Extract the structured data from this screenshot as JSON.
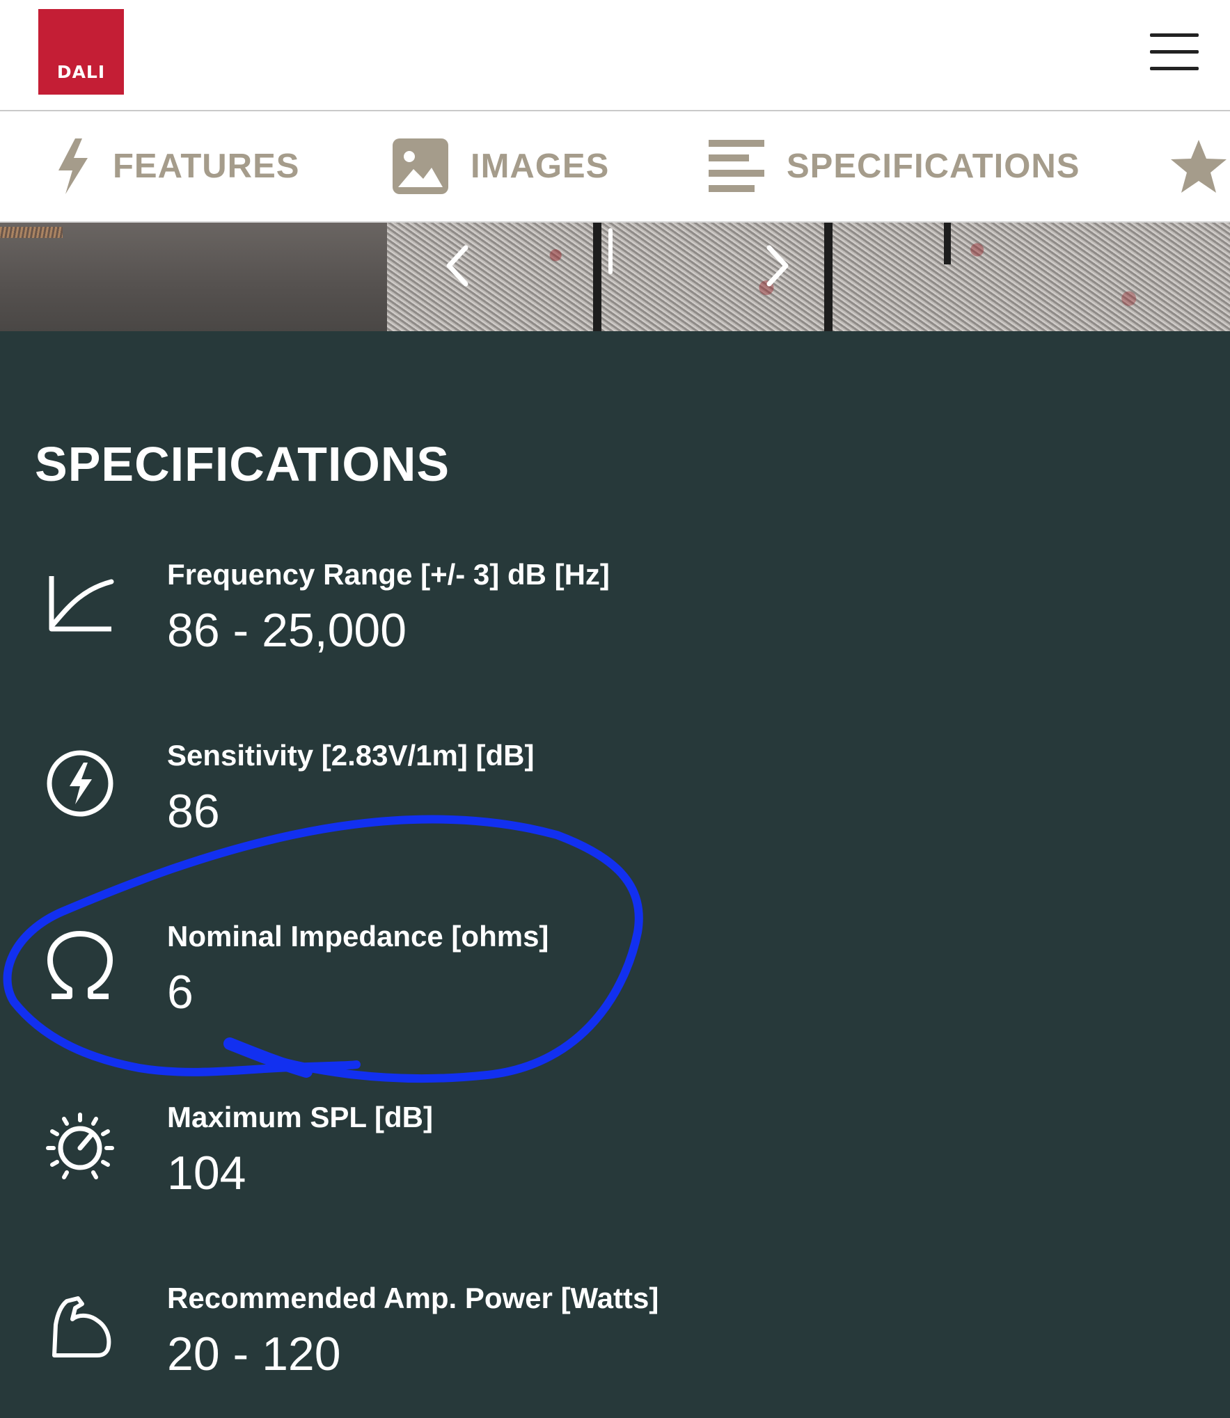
{
  "header": {
    "logo_text": "DALI",
    "brand_color": "#c41e35",
    "menu_icon": "hamburger-menu-icon"
  },
  "tabs": [
    {
      "label": "FEATURES",
      "icon": "lightning-icon"
    },
    {
      "label": "IMAGES",
      "icon": "image-icon"
    },
    {
      "label": "SPECIFICATIONS",
      "icon": "specifications-list-icon"
    },
    {
      "label": "",
      "icon": "star-icon"
    }
  ],
  "tab_color": "#a59c8b",
  "gallery": {
    "prev_icon": "chevron-left-icon",
    "next_icon": "chevron-right-icon"
  },
  "specifications": {
    "title": "SPECIFICATIONS",
    "background": "#27393a",
    "items": [
      {
        "label": "Frequency Range [+/- 3] dB [Hz]",
        "value": "86 - 25,000",
        "icon": "frequency-curve-icon"
      },
      {
        "label": "Sensitivity [2.83V/1m] [dB]",
        "value": "86",
        "icon": "lightning-circle-icon"
      },
      {
        "label": "Nominal Impedance [ohms]",
        "value": "6",
        "icon": "omega-icon"
      },
      {
        "label": "Maximum SPL [dB]",
        "value": "104",
        "icon": "gauge-icon"
      },
      {
        "label": "Recommended Amp. Power [Watts]",
        "value": "20 - 120",
        "icon": "flexed-arm-icon"
      }
    ]
  },
  "annotation": {
    "color": "#1230f0",
    "shape": "hand-drawn circle around Nominal Impedance"
  }
}
